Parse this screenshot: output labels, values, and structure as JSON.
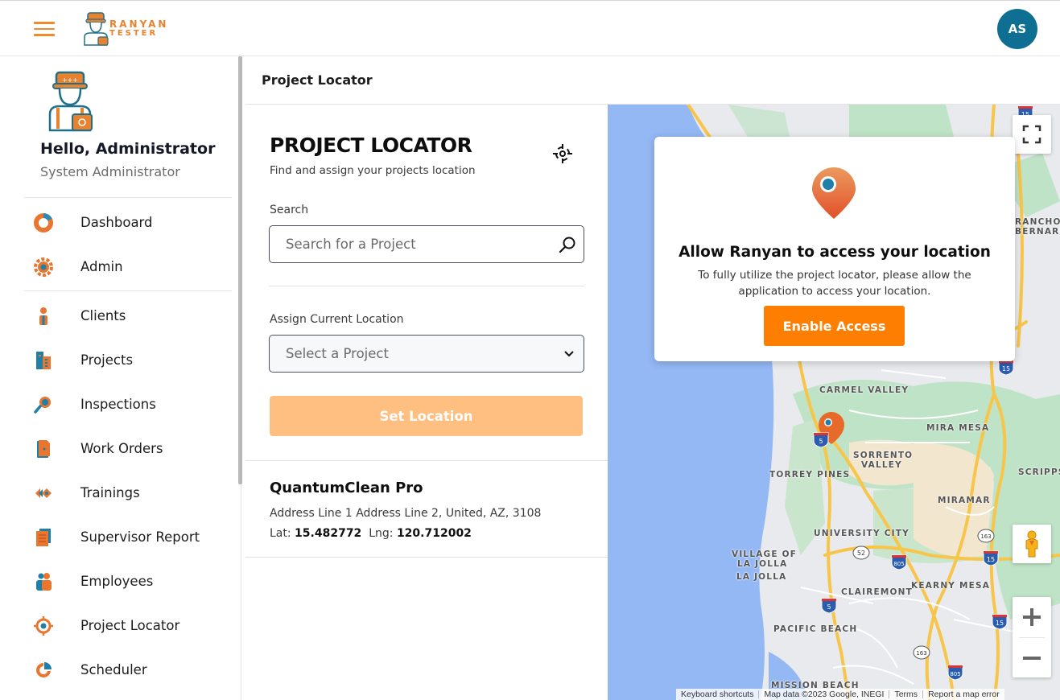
{
  "app": {
    "brand_line1": "RANYAN",
    "brand_line2": "TESTER",
    "avatar_initials": "AS",
    "colors": {
      "accent": "#f08a2c",
      "primary_button": "#fd7e00",
      "disabled_button": "#ffbf80",
      "avatar": "#0e6f93"
    }
  },
  "sidebar": {
    "greeting": "Hello, Administrator",
    "role": "System Administrator",
    "items": [
      {
        "label": "Dashboard",
        "icon": "donut-chart-icon"
      },
      {
        "label": "Admin",
        "icon": "gear-icon"
      },
      {
        "label": "Clients",
        "icon": "person-icon"
      },
      {
        "label": "Projects",
        "icon": "buildings-icon"
      },
      {
        "label": "Inspections",
        "icon": "magnifier-icon"
      },
      {
        "label": "Work Orders",
        "icon": "document-icon"
      },
      {
        "label": "Trainings",
        "icon": "arrows-icon"
      },
      {
        "label": "Supervisor Report",
        "icon": "report-icon"
      },
      {
        "label": "Employees",
        "icon": "people-icon"
      },
      {
        "label": "Project Locator",
        "icon": "target-icon"
      },
      {
        "label": "Scheduler",
        "icon": "pie-chart-icon"
      }
    ]
  },
  "page": {
    "header_title": "Project Locator"
  },
  "locator": {
    "title": "PROJECT LOCATOR",
    "subtitle": "Find and assign your projects location",
    "search_label": "Search",
    "search_placeholder": "Search for a Project",
    "assign_label": "Assign Current Location",
    "select_value": "Select a Project",
    "set_button": "Set Location",
    "project": {
      "name": "QuantumClean Pro",
      "address": "Address Line 1 Address Line 2, United, AZ, 3108",
      "lat_label": "Lat:",
      "lat": "15.482772",
      "lng_label": "Lng:",
      "lng": "120.712002"
    }
  },
  "modal": {
    "title": "Allow Ranyan to access your location",
    "body": "To fully utilize the project locator, please allow the application to access your location.",
    "button": "Enable Access"
  },
  "map": {
    "labels": [
      "CARMEL VALLEY",
      "MIRA MESA",
      "SORRENTO",
      "VALLEY",
      "TORREY PINES",
      "SCRIPPS",
      "MIRAMAR",
      "UNIVERSITY CITY",
      "VILLAGE OF",
      "LA JOLLA",
      "LA JOLLA",
      "KEARNY MESA",
      "CLAIREMONT",
      "PACIFIC BEACH",
      "MISSION BEACH",
      "RANCHO",
      "BERNARDO"
    ],
    "shields": [
      "15",
      "5",
      "5",
      "52",
      "805",
      "163",
      "15",
      "15",
      "163",
      "805",
      "15"
    ],
    "attribution": {
      "shortcuts": "Keyboard shortcuts",
      "data": "Map data ©2023 Google, INEGI",
      "terms": "Terms",
      "report": "Report a map error"
    }
  }
}
